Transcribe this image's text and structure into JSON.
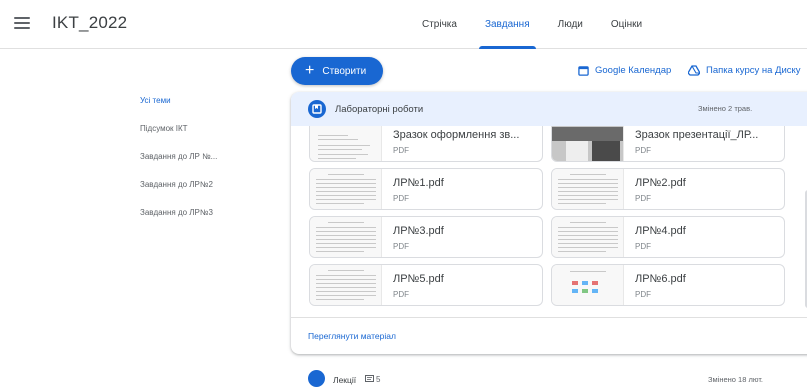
{
  "header": {
    "class_title": "IKT_2022",
    "tabs": [
      {
        "label": "Стрічка"
      },
      {
        "label": "Завдання"
      },
      {
        "label": "Люди"
      },
      {
        "label": "Оцінки"
      }
    ],
    "active_tab": "Завдання"
  },
  "toolbar": {
    "create_label": "Створити",
    "calendar_label": "Google Календар",
    "drive_label": "Папка курсу на Диску"
  },
  "sidebar": {
    "topics": [
      {
        "label": "Усі теми"
      },
      {
        "label": "Підсумок ІКТ"
      },
      {
        "label": "Завдання до ЛР №..."
      },
      {
        "label": "Завдання до ЛР№2"
      },
      {
        "label": "Завдання до ЛР№3"
      }
    ]
  },
  "section": {
    "title": "Лабораторні роботи",
    "changed": "Змінено 2 трав.",
    "files": [
      {
        "name": "Зразок оформлення зв...",
        "type": "PDF"
      },
      {
        "name": "Зразок презентації_ЛР...",
        "type": "PDF"
      },
      {
        "name": "ЛР№1.pdf",
        "type": "PDF"
      },
      {
        "name": "ЛР№2.pdf",
        "type": "PDF"
      },
      {
        "name": "ЛР№3.pdf",
        "type": "PDF"
      },
      {
        "name": "ЛР№4.pdf",
        "type": "PDF"
      },
      {
        "name": "ЛР№5.pdf",
        "type": "PDF"
      },
      {
        "name": "ЛР№6.pdf",
        "type": "PDF"
      }
    ],
    "view_label": "Переглянути матеріал"
  },
  "next_section": {
    "title": "Лекції",
    "count": "5",
    "changed": "Змінено 18 лют."
  },
  "colors": {
    "accent": "#1967d2",
    "header_bg": "#e8f0fe"
  }
}
